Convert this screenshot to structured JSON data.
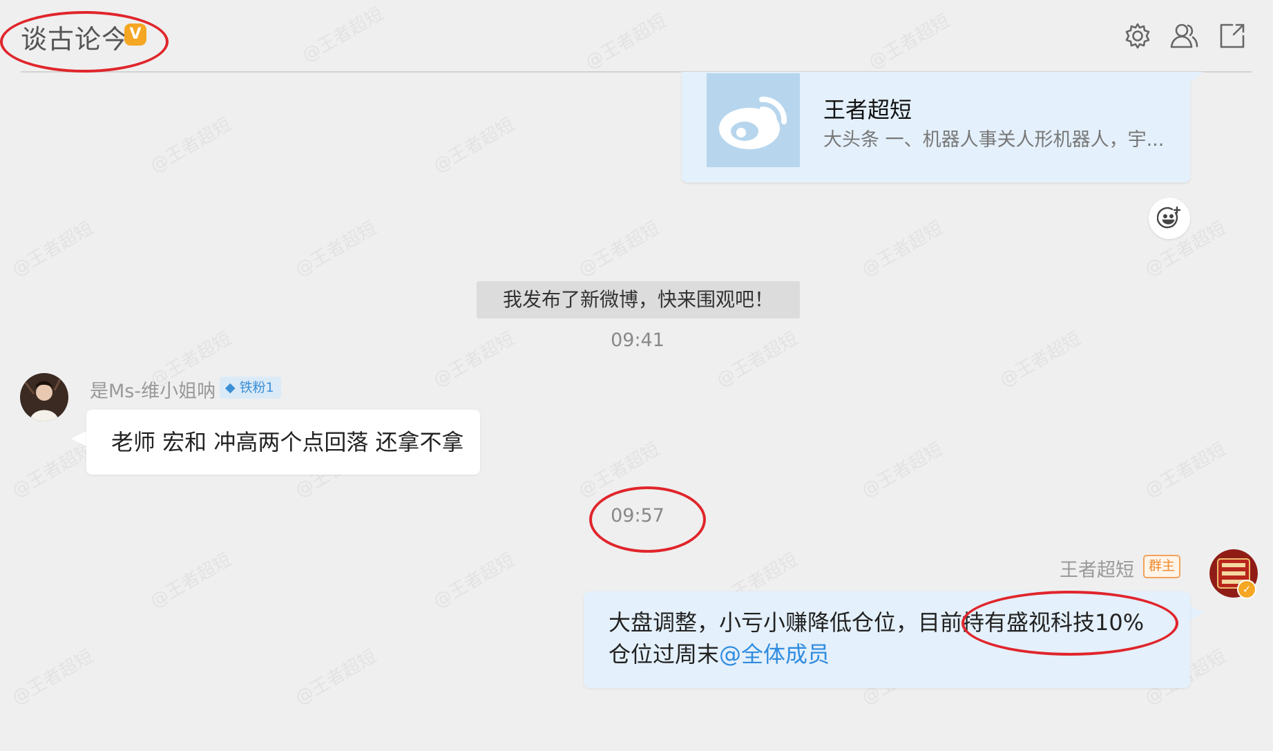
{
  "header": {
    "title": "谈古论今",
    "verified_mark": "V",
    "icons": [
      "gear-icon",
      "group-members-icon",
      "share-external-icon"
    ]
  },
  "watermark": "@王者超短",
  "shared_card": {
    "title": "王者超短",
    "description": "大头条 一、机器人事关人形机器人，宇..."
  },
  "system_message": "我发布了新微博，快来围观吧！",
  "messages": [
    {
      "time": "09:41",
      "sender": "是Ms-维小姐呐",
      "fan_badge": "铁粉1",
      "text": "老师 宏和 冲高两个点回落 还拿不拿",
      "side": "left"
    },
    {
      "time": "09:57",
      "sender": "王者超短",
      "role_badge": "群主",
      "text": "大盘调整，小亏小赚降低仓位，目前持有盛视科技10%仓位过周末",
      "mention": "@全体成员",
      "side": "right"
    }
  ],
  "colors": {
    "background": "#efefef",
    "own_bubble": "#e4f0fb",
    "mention": "#2f8ce0",
    "annotation": "#e0252b",
    "verified": "#f5a623",
    "owner_badge": "#f08a2e"
  }
}
